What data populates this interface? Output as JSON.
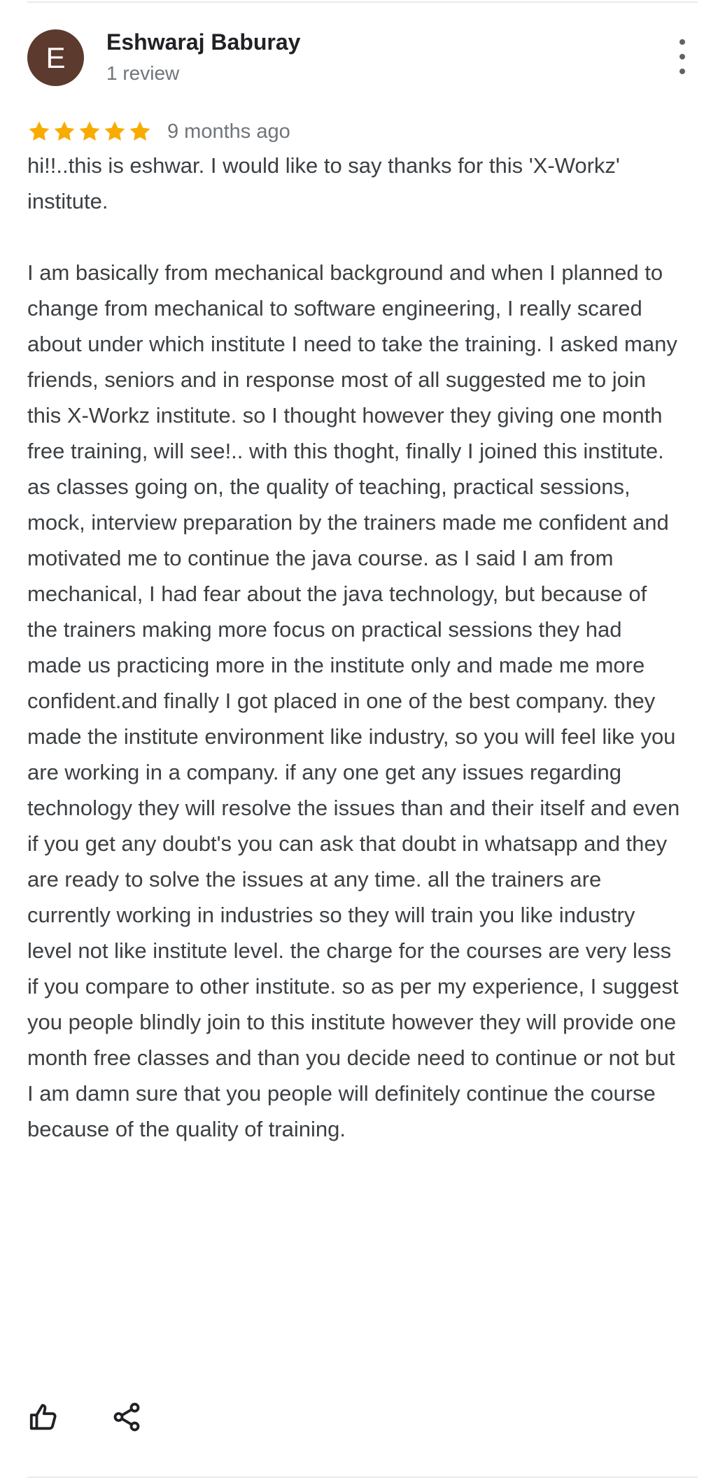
{
  "review": {
    "avatar_initial": "E",
    "avatar_color": "#5d3a2e",
    "author_name": "Eshwaraj Baburay",
    "author_meta": "1 review",
    "rating": 5,
    "rating_max": 5,
    "star_color": "#f9ab00",
    "date": "9 months ago",
    "text": "hi!!..this is eshwar. I would like to say thanks for this 'X-Workz'  institute.\n\nI am basically from mechanical background and when I planned to change from mechanical to software engineering, I really scared about under which institute I need to take the  training. I asked many friends, seniors and in response most of all suggested me to join this X-Workz institute. so I thought however they giving one month free training, will see!.. with this thoght, finally I joined this institute. as classes going on,  the quality of teaching, practical sessions, mock, interview preparation by the trainers made me confident and motivated me to continue the java course.  as I said I am from mechanical, I had fear about the java technology, but because of the trainers making more focus on practical sessions they had made us practicing more in the institute only and made me more confident.and finally I got placed in one of the best company. they made the institute environment like industry, so you will feel like you are working in a company. if any one get any issues regarding technology they will resolve the issues than and their itself and even  if you get any doubt's  you can ask that doubt in whatsapp and they are ready to solve the issues at any time. all the trainers are currently working in industries so they will train you like industry level not like institute level. the charge for the courses are very less if you compare to other institute. so as per my experience, I suggest you people  blindly join to this institute however they will provide one month free classes and than you decide need to continue or not but I am damn sure that you people will definitely continue the course because of the quality of training."
  },
  "actions": {
    "more_icon": "more-vertical-icon",
    "like_icon": "thumbs-up-icon",
    "share_icon": "share-icon"
  }
}
